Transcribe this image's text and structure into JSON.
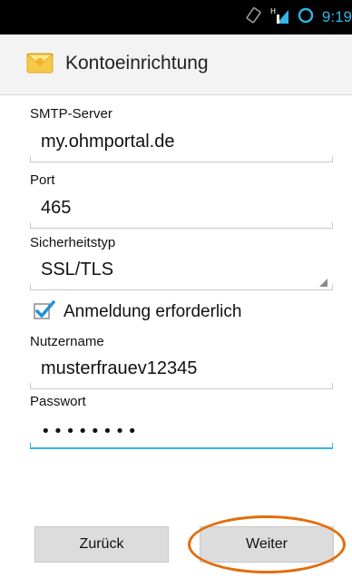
{
  "status_bar": {
    "time": "9:19",
    "icons": [
      "screen-rotate-icon",
      "signal-icon",
      "sync-icon"
    ]
  },
  "action_bar": {
    "title": "Kontoeinrichtung",
    "icon": "email-envelope-icon"
  },
  "form": {
    "smtp_label": "SMTP-Server",
    "smtp_value": "my.ohmportal.de",
    "port_label": "Port",
    "port_value": "465",
    "security_label": "Sicherheitstyp",
    "security_value": "SSL/TLS",
    "auth_label": "Anmeldung erforderlich",
    "auth_checked": true,
    "username_label": "Nutzername",
    "username_value": "musterfrauev12345",
    "password_label": "Passwort",
    "password_value": "••••••••"
  },
  "buttons": {
    "back": "Zurück",
    "next": "Weiter"
  },
  "colors": {
    "accent": "#33b5e5",
    "highlight": "#e36c09",
    "checkbox": "#1e90d6"
  }
}
